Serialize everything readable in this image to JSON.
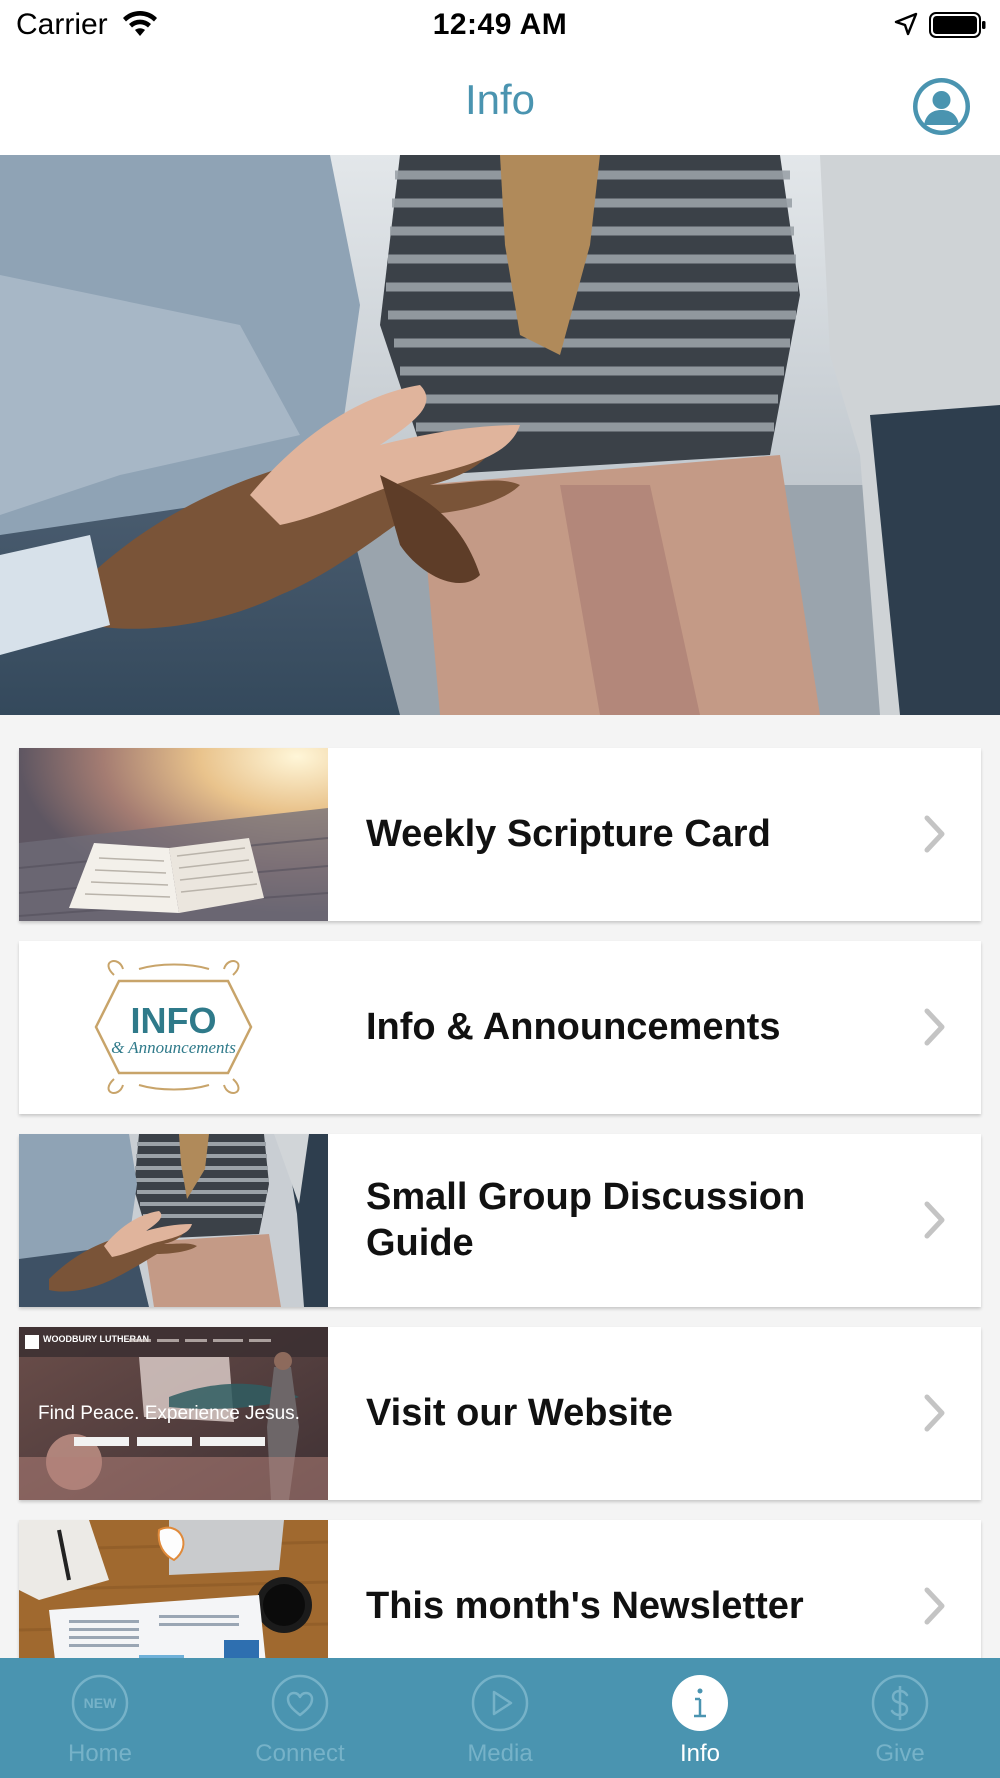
{
  "status_bar": {
    "carrier": "Carrier",
    "time": "12:49 AM"
  },
  "nav": {
    "title": "Info"
  },
  "list_items": [
    {
      "label": "Weekly Scripture Card",
      "thumb": "open-bible-on-dock"
    },
    {
      "label": "Info & Announcements",
      "thumb": "info-announcements-logo",
      "thumb_text": {
        "title": "INFO",
        "subtitle": "& Announcements"
      }
    },
    {
      "label": "Small Group Discussion Guide",
      "thumb": "group-discussion-photo"
    },
    {
      "label": "Visit our Website",
      "thumb": "website-screenshot",
      "thumb_text": {
        "brand": "WOODBURY LUTHERAN",
        "tagline": "Find Peace. Experience Jesus."
      }
    },
    {
      "label": "This month's Newsletter",
      "thumb": "newsletter-on-desk"
    }
  ],
  "tabs": [
    {
      "label": "Home",
      "icon": "new-badge-icon",
      "icon_text": "NEW",
      "active": false
    },
    {
      "label": "Connect",
      "icon": "heart-icon",
      "active": false
    },
    {
      "label": "Media",
      "icon": "play-icon",
      "active": false
    },
    {
      "label": "Info",
      "icon": "info-icon",
      "active": true
    },
    {
      "label": "Give",
      "icon": "dollar-icon",
      "active": false
    }
  ],
  "colors": {
    "accent": "#4a94b0",
    "tab_inactive": "#76b2c8",
    "tab_active": "#ffffff",
    "background": "#f4f4f4"
  }
}
